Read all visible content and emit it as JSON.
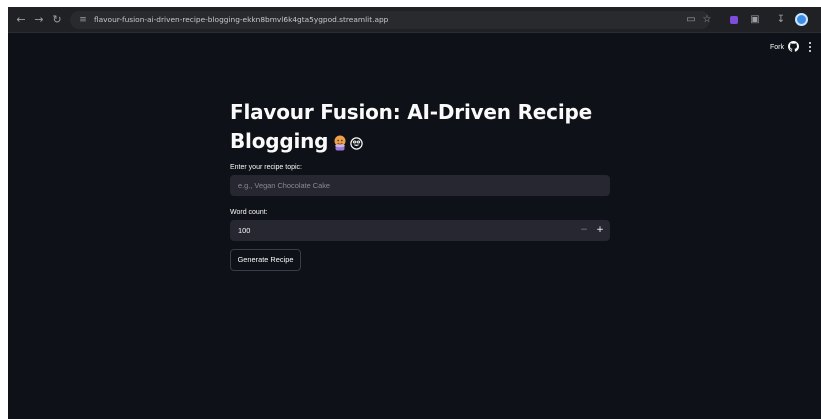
{
  "browser": {
    "url": "flavour-fusion-ai-driven-recipe-blogging-ekkn8bmvl6k4gta5ygpod.streamlit.app",
    "back_icon": "arrow-left-icon",
    "forward_icon": "arrow-right-icon",
    "reload_icon": "reload-icon",
    "site_info_icon": "tune-icon",
    "extensions": [
      "screen-cast-icon",
      "star-icon",
      "extension-purple-icon",
      "puzzle-icon",
      "download-icon",
      "profile-icon"
    ]
  },
  "header": {
    "fork_label": "Fork",
    "github_icon": "github-icon",
    "menu_icon": "kebab-menu-icon"
  },
  "main": {
    "title_line1": "Flavour Fusion: AI-Driven Recipe",
    "title_line2": "Blogging",
    "title_emojis": [
      "cook-icon",
      "yum-face-icon"
    ],
    "topic_label": "Enter your recipe topic:",
    "topic_placeholder": "e.g., Vegan Chocolate Cake",
    "topic_value": "",
    "word_count_label": "Word count:",
    "word_count_value": "100",
    "minus_label": "−",
    "plus_label": "+",
    "generate_label": "Generate Recipe"
  },
  "colors": {
    "app_bg": "#0e1117",
    "input_bg": "#262730",
    "text": "#fafafa",
    "placeholder": "#878a93"
  }
}
